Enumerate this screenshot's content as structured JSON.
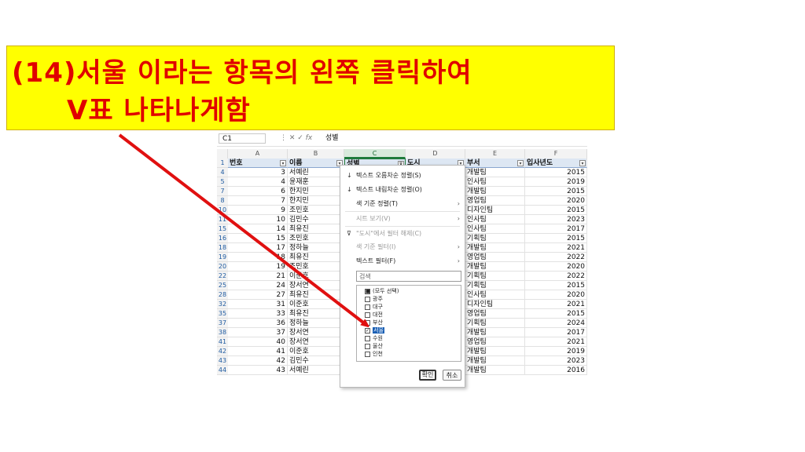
{
  "instruction": {
    "line1": "(14)서울 이라는 항목의 왼쪽 클릭하여",
    "line2": "V표 나타나게함"
  },
  "formula_bar": {
    "name_box": "C1",
    "fx": "fx",
    "value": "성별"
  },
  "columns": [
    "A",
    "B",
    "C",
    "D",
    "E",
    "F"
  ],
  "table": {
    "headers": {
      "num": "번호",
      "name": "이름",
      "gender": "성별",
      "city": "도시",
      "dept": "부서",
      "year": "입사년도"
    },
    "header_row_num": "1",
    "rows": [
      {
        "r": "4",
        "num": "3",
        "name": "서예린",
        "dept": "개발팀",
        "year": "2015"
      },
      {
        "r": "5",
        "num": "4",
        "name": "윤재훈",
        "dept": "인사팀",
        "year": "2019"
      },
      {
        "r": "7",
        "num": "6",
        "name": "한지민",
        "dept": "개발팀",
        "year": "2015"
      },
      {
        "r": "8",
        "num": "7",
        "name": "한지민",
        "dept": "영업팀",
        "year": "2020"
      },
      {
        "r": "10",
        "num": "9",
        "name": "조민호",
        "dept": "디자인팀",
        "year": "2015"
      },
      {
        "r": "11",
        "num": "10",
        "name": "김민수",
        "dept": "인사팀",
        "year": "2023"
      },
      {
        "r": "15",
        "num": "14",
        "name": "최유진",
        "dept": "인사팀",
        "year": "2017"
      },
      {
        "r": "16",
        "num": "15",
        "name": "조민호",
        "dept": "기획팀",
        "year": "2015"
      },
      {
        "r": "18",
        "num": "17",
        "name": "정하늘",
        "dept": "개발팀",
        "year": "2021"
      },
      {
        "r": "19",
        "num": "18",
        "name": "최유진",
        "dept": "영업팀",
        "year": "2022"
      },
      {
        "r": "20",
        "num": "19",
        "name": "조민호",
        "dept": "개발팀",
        "year": "2020"
      },
      {
        "r": "22",
        "num": "21",
        "name": "이준호",
        "dept": "기획팀",
        "year": "2022"
      },
      {
        "r": "25",
        "num": "24",
        "name": "장서연",
        "dept": "기획팀",
        "year": "2015"
      },
      {
        "r": "28",
        "num": "27",
        "name": "최유진",
        "dept": "인사팀",
        "year": "2020"
      },
      {
        "r": "32",
        "num": "31",
        "name": "이준호",
        "dept": "디자인팀",
        "year": "2021"
      },
      {
        "r": "35",
        "num": "33",
        "name": "최유진",
        "dept": "영업팀",
        "year": "2015"
      },
      {
        "r": "37",
        "num": "36",
        "name": "정하늘",
        "dept": "기획팀",
        "year": "2024"
      },
      {
        "r": "38",
        "num": "37",
        "name": "장서연",
        "dept": "개발팀",
        "year": "2017"
      },
      {
        "r": "41",
        "num": "40",
        "name": "장서연",
        "dept": "영업팀",
        "year": "2021"
      },
      {
        "r": "42",
        "num": "41",
        "name": "이준호",
        "dept": "개발팀",
        "year": "2019"
      },
      {
        "r": "43",
        "num": "42",
        "name": "김민수",
        "dept": "개발팀",
        "year": "2023"
      },
      {
        "r": "44",
        "num": "43",
        "name": "서예린",
        "gender": "남",
        "city": "광주",
        "dept": "개발팀",
        "year": "2016"
      }
    ]
  },
  "filter_menu": {
    "sort_asc": "텍스트 오름차순 정렬(S)",
    "sort_desc": "텍스트 내림차순 정렬(O)",
    "sort_color": "색 기준 정렬(T)",
    "sheet_view": "시트 보기(V)",
    "clear_filter": "\"도시\"에서 필터 해제(C)",
    "filter_color": "색 기준 필터(I)",
    "text_filter": "텍스트 필터(F)",
    "search_placeholder": "검색",
    "items": [
      {
        "label": "(모두 선택)",
        "checked": "partial"
      },
      {
        "label": "광주",
        "checked": false
      },
      {
        "label": "대구",
        "checked": false
      },
      {
        "label": "대전",
        "checked": false
      },
      {
        "label": "부산",
        "checked": false
      },
      {
        "label": "서울",
        "checked": true
      },
      {
        "label": "수원",
        "checked": false
      },
      {
        "label": "울산",
        "checked": false
      },
      {
        "label": "인천",
        "checked": false
      }
    ],
    "ok": "확인",
    "cancel": "취소"
  },
  "colors": {
    "banner_bg": "#ffff00",
    "banner_text": "#e00000",
    "arrow": "#e01010",
    "header_bg": "#dde7f3",
    "selected": "#1a5fb4"
  }
}
